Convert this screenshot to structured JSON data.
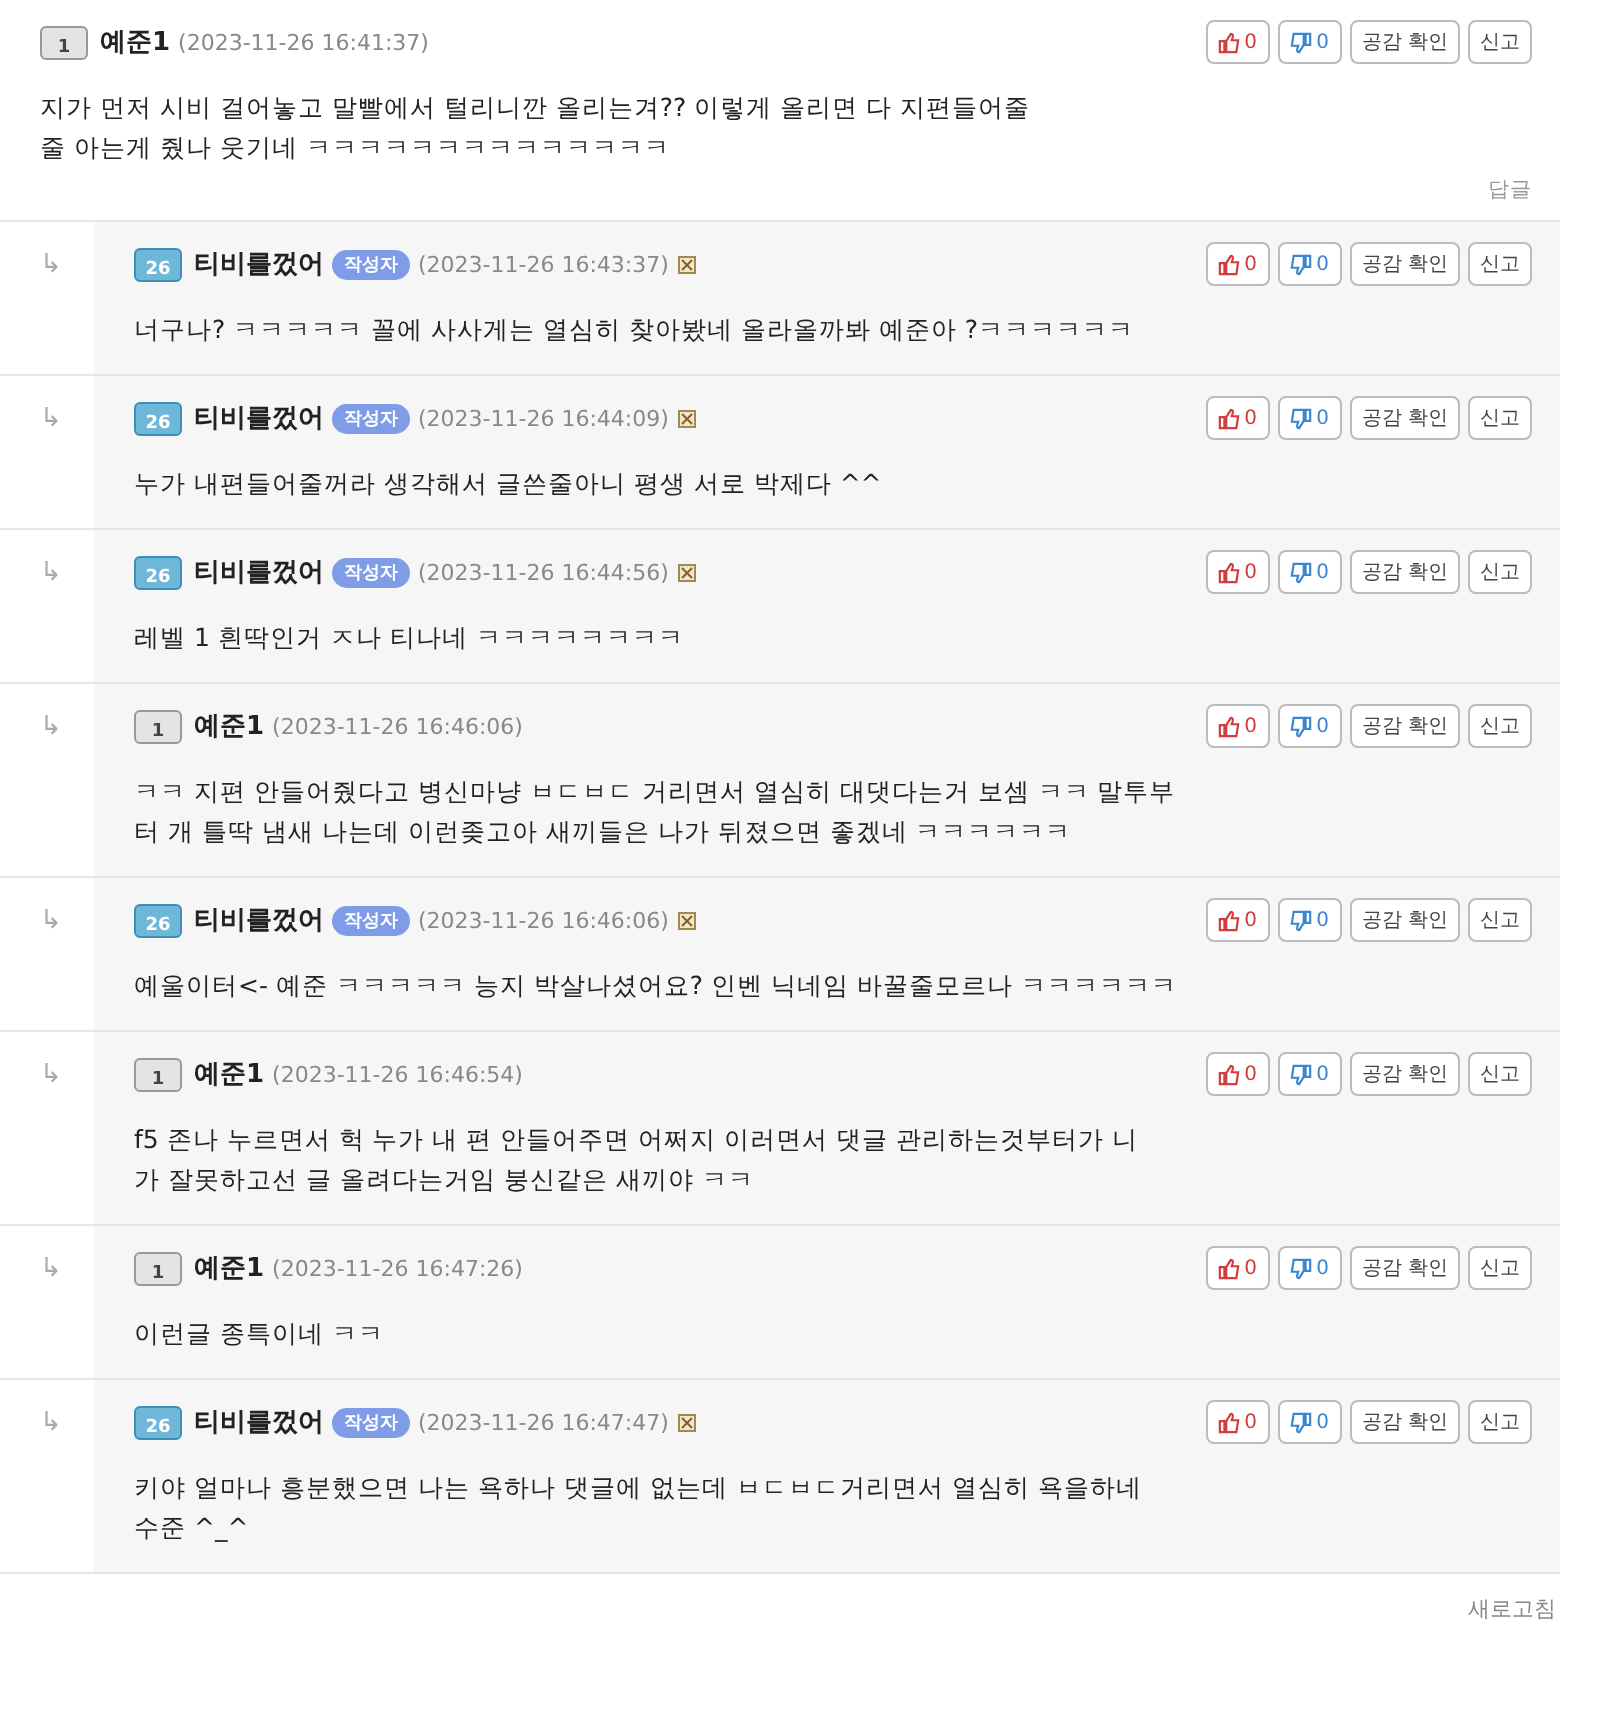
{
  "comments": [
    {
      "kind": "main",
      "author": "예준1",
      "level": "1",
      "timestamp": "(2023-11-26 16:41:37)",
      "marked": false,
      "likes": "0",
      "dislikes": "0",
      "empathy": "공감 확인",
      "report": "신고",
      "lines": [
        "지가 먼저 시비 걸어놓고 말빨에서 털리니깐 올리는겨?? 이렇게 올리면 다 지편들어줄",
        "줄 아는게 줬나 웃기네 ㅋㅋㅋㅋㅋㅋㅋㅋㅋㅋㅋㅋㅋㅋ"
      ],
      "reply_link": "답글"
    },
    {
      "kind": "reply",
      "arrow": "↳",
      "author": "티비를껐어",
      "level": "26",
      "badge": "작성자",
      "timestamp": "(2023-11-26 16:43:37)",
      "marked": true,
      "likes": "0",
      "dislikes": "0",
      "empathy": "공감 확인",
      "report": "신고",
      "lines": [
        "너구나? ㅋㅋㅋㅋㅋ 꼴에 사사게는 열심히 찾아봤네 올라올까봐 예준아 ?ㅋㅋㅋㅋㅋㅋ"
      ]
    },
    {
      "kind": "reply",
      "arrow": "↳",
      "author": "티비를껐어",
      "level": "26",
      "badge": "작성자",
      "timestamp": "(2023-11-26 16:44:09)",
      "marked": true,
      "likes": "0",
      "dislikes": "0",
      "empathy": "공감 확인",
      "report": "신고",
      "lines": [
        "누가 내편들어줄꺼라 생각해서 글쓴줄아니 평생 서로 박제다 ^^"
      ]
    },
    {
      "kind": "reply",
      "arrow": "↳",
      "author": "티비를껐어",
      "level": "26",
      "badge": "작성자",
      "timestamp": "(2023-11-26 16:44:56)",
      "marked": true,
      "likes": "0",
      "dislikes": "0",
      "empathy": "공감 확인",
      "report": "신고",
      "lines": [
        "레벨 1 흰딱인거 ㅈ나 티나네 ㅋㅋㅋㅋㅋㅋㅋㅋ"
      ]
    },
    {
      "kind": "reply",
      "arrow": "↳",
      "author": "예준1",
      "level": "1",
      "timestamp": "(2023-11-26 16:46:06)",
      "marked": false,
      "likes": "0",
      "dislikes": "0",
      "empathy": "공감 확인",
      "report": "신고",
      "lines": [
        "ㅋㅋ 지편 안들어줬다고 병신마냥 ㅂㄷㅂㄷ 거리면서 열심히 대댓다는거 보셈 ㅋㅋ 말투부",
        "터 개 틀딱 냄새 나는데 이런좆고아 새끼들은 나가 뒤졌으면 좋겠네 ㅋㅋㅋㅋㅋㅋ"
      ]
    },
    {
      "kind": "reply",
      "arrow": "↳",
      "author": "티비를껐어",
      "level": "26",
      "badge": "작성자",
      "timestamp": "(2023-11-26 16:46:06)",
      "marked": true,
      "likes": "0",
      "dislikes": "0",
      "empathy": "공감 확인",
      "report": "신고",
      "lines": [
        "예울이터<- 예준 ㅋㅋㅋㅋㅋ 능지 박살나셨어요? 인벤 닉네임 바꿀줄모르나 ㅋㅋㅋㅋㅋㅋ"
      ]
    },
    {
      "kind": "reply",
      "arrow": "↳",
      "author": "예준1",
      "level": "1",
      "timestamp": "(2023-11-26 16:46:54)",
      "marked": false,
      "likes": "0",
      "dislikes": "0",
      "empathy": "공감 확인",
      "report": "신고",
      "lines": [
        "f5 존나 누르면서 헉 누가 내 편 안들어주면 어쩌지 이러면서 댓글 관리하는것부터가 니",
        "가 잘못하고선 글 올려다는거임 붕신같은 새끼야 ㅋㅋ"
      ]
    },
    {
      "kind": "reply",
      "arrow": "↳",
      "author": "예준1",
      "level": "1",
      "timestamp": "(2023-11-26 16:47:26)",
      "marked": false,
      "likes": "0",
      "dislikes": "0",
      "empathy": "공감 확인",
      "report": "신고",
      "lines": [
        "이런글 종특이네 ㅋㅋ"
      ]
    },
    {
      "kind": "reply",
      "arrow": "↳",
      "author": "티비를껐어",
      "level": "26",
      "badge": "작성자",
      "timestamp": "(2023-11-26 16:47:47)",
      "marked": true,
      "likes": "0",
      "dislikes": "0",
      "empathy": "공감 확인",
      "report": "신고",
      "lines": [
        "키야 얼마나 흥분했으면 나는 욕하나 댓글에 없는데 ㅂㄷㅂㄷ거리면서 열심히 욕을하네",
        "수준 ^_^"
      ]
    }
  ],
  "refresh": "새로고침"
}
